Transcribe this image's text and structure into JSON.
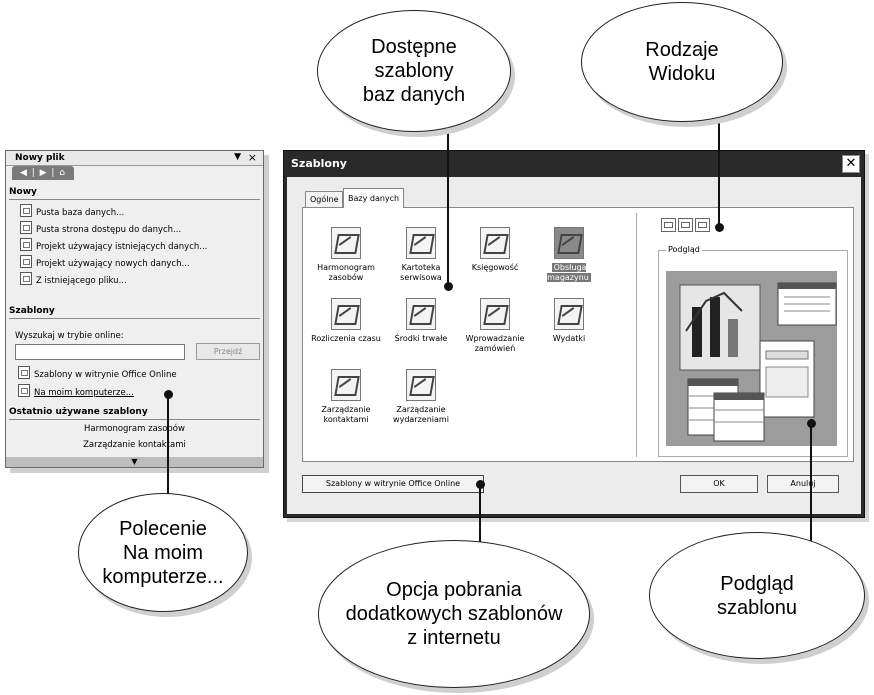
{
  "task_pane": {
    "title": "Nowy plik",
    "dropdown_glyph": "▼",
    "close_glyph": "×",
    "nav_glyphs": "◀ | ▶ | ⌂",
    "section_new": "Nowy",
    "new_items": [
      "Pusta baza danych...",
      "Pusta strona dostępu do danych...",
      "Projekt używający istniejących danych...",
      "Projekt używający nowych danych...",
      "Z istniejącego pliku..."
    ],
    "section_templates": "Szablony",
    "search_label": "Wyszukaj w trybie online:",
    "search_value": "",
    "go_button": "Przejdź",
    "templates_online": "Szablony w witrynie Office Online",
    "templates_local": "Na moim komputerze...",
    "section_recent": "Ostatnio używane szablony",
    "recent_items": [
      "Harmonogram zasobów",
      "Zarządzanie kontaktami"
    ],
    "scroll_glyph": "▼"
  },
  "dialog": {
    "title": "Szablony",
    "close_glyph": "✕",
    "tabs": [
      "Ogólne",
      "Bazy danych"
    ],
    "templates": [
      "Harmonogram zasobów",
      "Kartoteka serwisowa",
      "Księgowość",
      "Obsługa magazynu",
      "Rozliczenia czasu",
      "Środki trwałe",
      "Wprowadzanie zamówień",
      "Wydatki",
      "Zarządzanie kontaktami",
      "Zarządzanie wydarzeniami"
    ],
    "selected_template": "Obsługa magazynu",
    "preview_label": "Podgląd",
    "online_button": "Szablony w witrynie Office Online",
    "ok_button": "OK",
    "cancel_button": "Anuluj"
  },
  "callouts": {
    "available_templates": "Dostępne\nszablony\nbaz danych",
    "view_types": "Rodzaje\nWidoku",
    "on_my_computer": "Polecenie\nNa moim\nkomputerze...",
    "download_option": "Opcja pobrania\ndodatkowych szablonów\nz internetu",
    "template_preview": "Podgląd\nszablonu"
  }
}
